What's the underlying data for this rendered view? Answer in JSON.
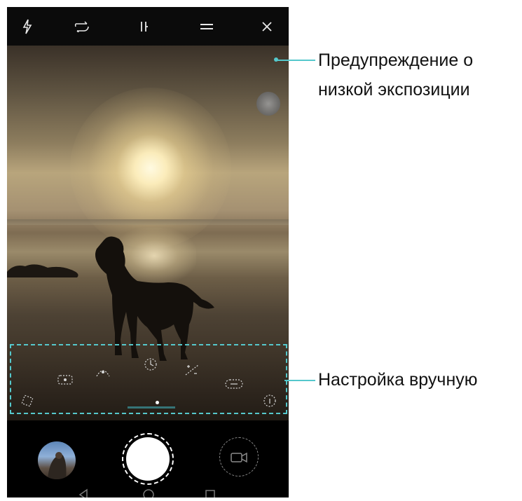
{
  "topbar": {
    "icons": [
      "flash-icon",
      "hdr-icon",
      "timer-icon",
      "menu-icon",
      "close-icon"
    ]
  },
  "viewfinder": {
    "scene": "beach-sunset-dog"
  },
  "manual_panel": {
    "dials": [
      "metering-icon",
      "iso-icon",
      "shutter-speed-icon",
      "exposure-icon",
      "focus-icon",
      "white-balance-icon",
      "reset-icon",
      "info-icon"
    ]
  },
  "bottombar": {
    "icons": [
      "gallery-thumbnail",
      "shutter-button",
      "video-switch-icon"
    ],
    "nav": [
      "back-icon",
      "home-icon",
      "recents-icon"
    ]
  },
  "callouts": {
    "exposure_warning": "Предупреждение о\nнизкой экспозиции",
    "exposure_warning_line1": "Предупреждение о",
    "exposure_warning_line2": "низкой экспозиции",
    "manual_settings": "Настройка вручную"
  },
  "colors": {
    "callout_accent": "#55c8cc",
    "bar_background": "#000000"
  }
}
